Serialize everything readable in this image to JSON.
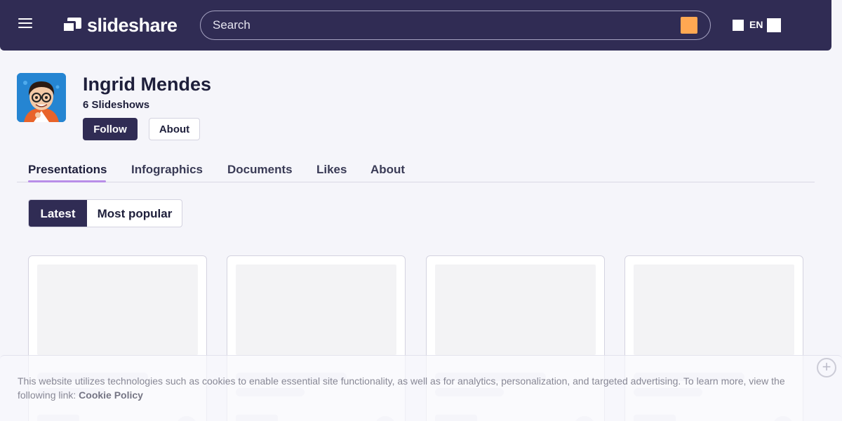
{
  "header": {
    "menu_icon": "hamburger-menu-icon",
    "logo_text": "slideshare",
    "search_placeholder": "Search",
    "search_icon": "search-icon",
    "language": "EN",
    "colors": {
      "bar": "#302c54",
      "search_button": "#ffa852"
    }
  },
  "profile": {
    "name": "Ingrid Mendes",
    "count_label": "6 Slideshows",
    "follow_label": "Follow",
    "about_label": "About"
  },
  "tabs": [
    {
      "label": "Presentations",
      "active": true
    },
    {
      "label": "Infographics",
      "active": false
    },
    {
      "label": "Documents",
      "active": false
    },
    {
      "label": "Likes",
      "active": false
    },
    {
      "label": "About",
      "active": false
    }
  ],
  "sort_toggle": {
    "latest": "Latest",
    "popular": "Most popular",
    "selected": "Latest"
  },
  "cards_loading_count": 4,
  "cookie_banner": {
    "text": "This website utilizes technologies such as cookies to enable essential site functionality, as well as for analytics, personalization, and targeted advertising. To learn more, view the following link:",
    "link_label": "Cookie Policy",
    "close_icon": "close-circle-icon"
  },
  "accent_colors": {
    "tab_underline": "#b98ee8",
    "primary_button": "#302c54"
  }
}
